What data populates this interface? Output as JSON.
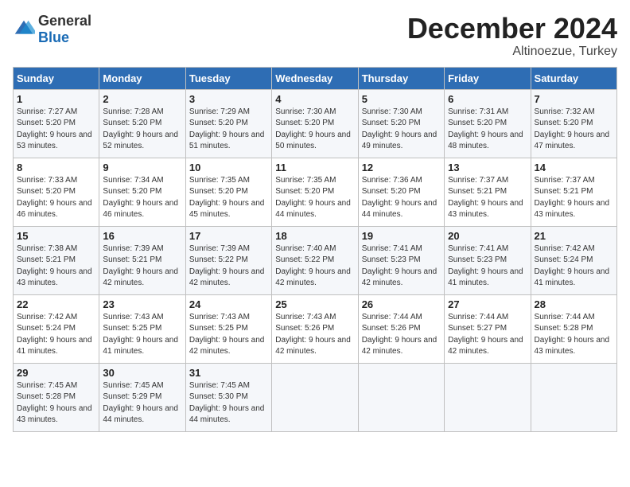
{
  "logo": {
    "general": "General",
    "blue": "Blue"
  },
  "header": {
    "month": "December 2024",
    "location": "Altinoezue, Turkey"
  },
  "weekdays": [
    "Sunday",
    "Monday",
    "Tuesday",
    "Wednesday",
    "Thursday",
    "Friday",
    "Saturday"
  ],
  "weeks": [
    [
      {
        "day": "1",
        "sunrise": "Sunrise: 7:27 AM",
        "sunset": "Sunset: 5:20 PM",
        "daylight": "Daylight: 9 hours and 53 minutes."
      },
      {
        "day": "2",
        "sunrise": "Sunrise: 7:28 AM",
        "sunset": "Sunset: 5:20 PM",
        "daylight": "Daylight: 9 hours and 52 minutes."
      },
      {
        "day": "3",
        "sunrise": "Sunrise: 7:29 AM",
        "sunset": "Sunset: 5:20 PM",
        "daylight": "Daylight: 9 hours and 51 minutes."
      },
      {
        "day": "4",
        "sunrise": "Sunrise: 7:30 AM",
        "sunset": "Sunset: 5:20 PM",
        "daylight": "Daylight: 9 hours and 50 minutes."
      },
      {
        "day": "5",
        "sunrise": "Sunrise: 7:30 AM",
        "sunset": "Sunset: 5:20 PM",
        "daylight": "Daylight: 9 hours and 49 minutes."
      },
      {
        "day": "6",
        "sunrise": "Sunrise: 7:31 AM",
        "sunset": "Sunset: 5:20 PM",
        "daylight": "Daylight: 9 hours and 48 minutes."
      },
      {
        "day": "7",
        "sunrise": "Sunrise: 7:32 AM",
        "sunset": "Sunset: 5:20 PM",
        "daylight": "Daylight: 9 hours and 47 minutes."
      }
    ],
    [
      {
        "day": "8",
        "sunrise": "Sunrise: 7:33 AM",
        "sunset": "Sunset: 5:20 PM",
        "daylight": "Daylight: 9 hours and 46 minutes."
      },
      {
        "day": "9",
        "sunrise": "Sunrise: 7:34 AM",
        "sunset": "Sunset: 5:20 PM",
        "daylight": "Daylight: 9 hours and 46 minutes."
      },
      {
        "day": "10",
        "sunrise": "Sunrise: 7:35 AM",
        "sunset": "Sunset: 5:20 PM",
        "daylight": "Daylight: 9 hours and 45 minutes."
      },
      {
        "day": "11",
        "sunrise": "Sunrise: 7:35 AM",
        "sunset": "Sunset: 5:20 PM",
        "daylight": "Daylight: 9 hours and 44 minutes."
      },
      {
        "day": "12",
        "sunrise": "Sunrise: 7:36 AM",
        "sunset": "Sunset: 5:20 PM",
        "daylight": "Daylight: 9 hours and 44 minutes."
      },
      {
        "day": "13",
        "sunrise": "Sunrise: 7:37 AM",
        "sunset": "Sunset: 5:21 PM",
        "daylight": "Daylight: 9 hours and 43 minutes."
      },
      {
        "day": "14",
        "sunrise": "Sunrise: 7:37 AM",
        "sunset": "Sunset: 5:21 PM",
        "daylight": "Daylight: 9 hours and 43 minutes."
      }
    ],
    [
      {
        "day": "15",
        "sunrise": "Sunrise: 7:38 AM",
        "sunset": "Sunset: 5:21 PM",
        "daylight": "Daylight: 9 hours and 43 minutes."
      },
      {
        "day": "16",
        "sunrise": "Sunrise: 7:39 AM",
        "sunset": "Sunset: 5:21 PM",
        "daylight": "Daylight: 9 hours and 42 minutes."
      },
      {
        "day": "17",
        "sunrise": "Sunrise: 7:39 AM",
        "sunset": "Sunset: 5:22 PM",
        "daylight": "Daylight: 9 hours and 42 minutes."
      },
      {
        "day": "18",
        "sunrise": "Sunrise: 7:40 AM",
        "sunset": "Sunset: 5:22 PM",
        "daylight": "Daylight: 9 hours and 42 minutes."
      },
      {
        "day": "19",
        "sunrise": "Sunrise: 7:41 AM",
        "sunset": "Sunset: 5:23 PM",
        "daylight": "Daylight: 9 hours and 42 minutes."
      },
      {
        "day": "20",
        "sunrise": "Sunrise: 7:41 AM",
        "sunset": "Sunset: 5:23 PM",
        "daylight": "Daylight: 9 hours and 41 minutes."
      },
      {
        "day": "21",
        "sunrise": "Sunrise: 7:42 AM",
        "sunset": "Sunset: 5:24 PM",
        "daylight": "Daylight: 9 hours and 41 minutes."
      }
    ],
    [
      {
        "day": "22",
        "sunrise": "Sunrise: 7:42 AM",
        "sunset": "Sunset: 5:24 PM",
        "daylight": "Daylight: 9 hours and 41 minutes."
      },
      {
        "day": "23",
        "sunrise": "Sunrise: 7:43 AM",
        "sunset": "Sunset: 5:25 PM",
        "daylight": "Daylight: 9 hours and 41 minutes."
      },
      {
        "day": "24",
        "sunrise": "Sunrise: 7:43 AM",
        "sunset": "Sunset: 5:25 PM",
        "daylight": "Daylight: 9 hours and 42 minutes."
      },
      {
        "day": "25",
        "sunrise": "Sunrise: 7:43 AM",
        "sunset": "Sunset: 5:26 PM",
        "daylight": "Daylight: 9 hours and 42 minutes."
      },
      {
        "day": "26",
        "sunrise": "Sunrise: 7:44 AM",
        "sunset": "Sunset: 5:26 PM",
        "daylight": "Daylight: 9 hours and 42 minutes."
      },
      {
        "day": "27",
        "sunrise": "Sunrise: 7:44 AM",
        "sunset": "Sunset: 5:27 PM",
        "daylight": "Daylight: 9 hours and 42 minutes."
      },
      {
        "day": "28",
        "sunrise": "Sunrise: 7:44 AM",
        "sunset": "Sunset: 5:28 PM",
        "daylight": "Daylight: 9 hours and 43 minutes."
      }
    ],
    [
      {
        "day": "29",
        "sunrise": "Sunrise: 7:45 AM",
        "sunset": "Sunset: 5:28 PM",
        "daylight": "Daylight: 9 hours and 43 minutes."
      },
      {
        "day": "30",
        "sunrise": "Sunrise: 7:45 AM",
        "sunset": "Sunset: 5:29 PM",
        "daylight": "Daylight: 9 hours and 44 minutes."
      },
      {
        "day": "31",
        "sunrise": "Sunrise: 7:45 AM",
        "sunset": "Sunset: 5:30 PM",
        "daylight": "Daylight: 9 hours and 44 minutes."
      },
      null,
      null,
      null,
      null
    ]
  ]
}
